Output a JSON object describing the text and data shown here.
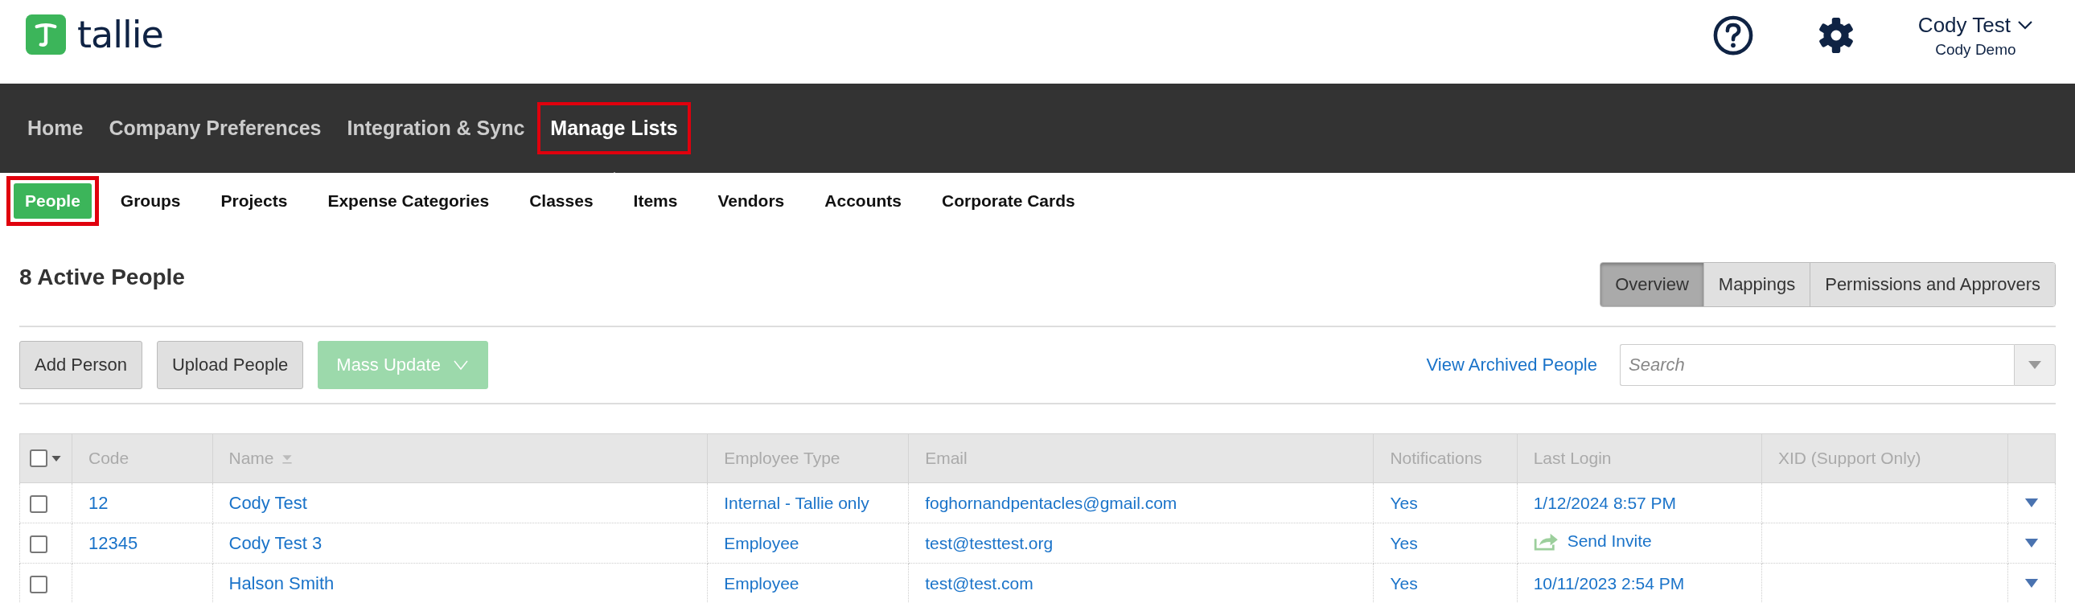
{
  "header": {
    "logo_text": "tallie",
    "user": {
      "name": "Cody Test",
      "company": "Cody Demo"
    }
  },
  "main_nav": [
    {
      "label": "Home",
      "selected": false,
      "highlighted": false
    },
    {
      "label": "Company Preferences",
      "selected": false,
      "highlighted": false
    },
    {
      "label": "Integration & Sync",
      "selected": false,
      "highlighted": false
    },
    {
      "label": "Manage Lists",
      "selected": true,
      "highlighted": true
    }
  ],
  "sub_nav": [
    {
      "label": "People",
      "selected": true,
      "highlighted": true
    },
    {
      "label": "Groups",
      "selected": false,
      "highlighted": false
    },
    {
      "label": "Projects",
      "selected": false,
      "highlighted": false
    },
    {
      "label": "Expense Categories",
      "selected": false,
      "highlighted": false
    },
    {
      "label": "Classes",
      "selected": false,
      "highlighted": false
    },
    {
      "label": "Items",
      "selected": false,
      "highlighted": false
    },
    {
      "label": "Vendors",
      "selected": false,
      "highlighted": false
    },
    {
      "label": "Accounts",
      "selected": false,
      "highlighted": false
    },
    {
      "label": "Corporate Cards",
      "selected": false,
      "highlighted": false
    }
  ],
  "page_title": "8 Active People",
  "view_tabs": [
    {
      "label": "Overview",
      "selected": true
    },
    {
      "label": "Mappings",
      "selected": false
    },
    {
      "label": "Permissions and Approvers",
      "selected": false
    }
  ],
  "toolbar": {
    "buttons": [
      {
        "label": "Add Person",
        "kind": "plain",
        "disabled": false
      },
      {
        "label": "Upload People",
        "kind": "plain",
        "disabled": false
      },
      {
        "label": "Mass Update",
        "kind": "dropdown",
        "disabled": true
      }
    ],
    "archived_link": "View Archived People",
    "search": {
      "placeholder": "Search"
    }
  },
  "table": {
    "select_all_checked": false,
    "columns": [
      "Code",
      "Name",
      "Employee Type",
      "Email",
      "Notifications",
      "Last Login",
      "XID (Support Only)"
    ],
    "rows": [
      {
        "checked": false,
        "code": "12",
        "name": "Cody Test",
        "employee_type": "Internal - Tallie only",
        "email": "foghornandpentacles@gmail.com",
        "notifications": "Yes",
        "last_login": {
          "kind": "date",
          "text": "1/12/2024 8:57 PM"
        }
      },
      {
        "checked": false,
        "code": "12345",
        "name": "Cody Test 3",
        "employee_type": "Employee",
        "email": "test@testtest.org",
        "notifications": "Yes",
        "last_login": {
          "kind": "invite",
          "text": "Send Invite"
        }
      },
      {
        "checked": false,
        "code": "",
        "name": "Halson Smith",
        "employee_type": "Employee",
        "email": "test@test.com",
        "notifications": "Yes",
        "last_login": {
          "kind": "date",
          "text": "10/11/2023 2:54 PM"
        }
      }
    ]
  }
}
